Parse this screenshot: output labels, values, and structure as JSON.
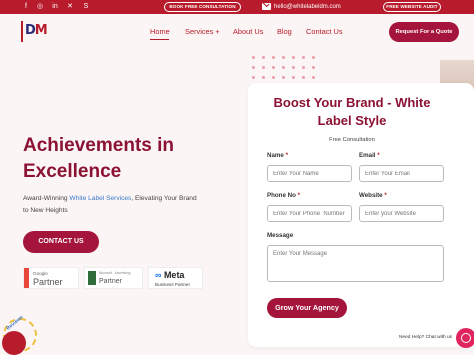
{
  "topbar": {
    "social_icons": [
      "facebook-icon",
      "instagram-icon",
      "linkedin-icon",
      "x-icon",
      "skype-icon"
    ],
    "consultation_label": "BOOK FREE CONSULTATION",
    "email": "hello@whitelabeldm.com",
    "audit_label": "FREE WEBSITE AUDIT"
  },
  "nav": {
    "logo_text_left": "D",
    "logo_text_right": "M",
    "items": [
      {
        "label": "Home"
      },
      {
        "label": "Services +"
      },
      {
        "label": "About Us"
      },
      {
        "label": "Blog"
      },
      {
        "label": "Contact Us"
      }
    ],
    "quote_button": "Request For a Quote"
  },
  "hero": {
    "title": "Achievements in Excellence",
    "subtitle_pre": "Award-Winning ",
    "subtitle_highlight": "White Label Services",
    "subtitle_post": ", Elevating Your Brand to New Heights",
    "cta": "CONTACT US"
  },
  "badges": {
    "google_small": "Google",
    "google_big": "Partner",
    "ms_small": "Microsoft · Advertising",
    "ms_big": "Partner",
    "meta_logo": "Meta",
    "meta_sub": "Business Partner"
  },
  "reviews": {
    "label": "Reviews"
  },
  "form": {
    "title": "Boost Your Brand - White Label Style",
    "subtitle": "Free Consultation",
    "name_label": "Name",
    "name_placeholder": "Enter Your Name",
    "email_label": "Email",
    "email_placeholder": "Enter Your Email",
    "phone_label": "Phone No",
    "phone_placeholder": "Enter Your Phone  Number",
    "website_label": "Website",
    "website_placeholder": "Enter your Website",
    "message_label": "Message",
    "message_placeholder": "Enter Your Message",
    "required_mark": "*",
    "submit": "Grow Your Agency"
  },
  "chat": {
    "help_text": "Need Help? Chat with us"
  },
  "colors": {
    "brand_red": "#b81c2c",
    "brand_maroon": "#8c1234",
    "button": "#a5143b",
    "link_blue": "#3a78c8"
  }
}
